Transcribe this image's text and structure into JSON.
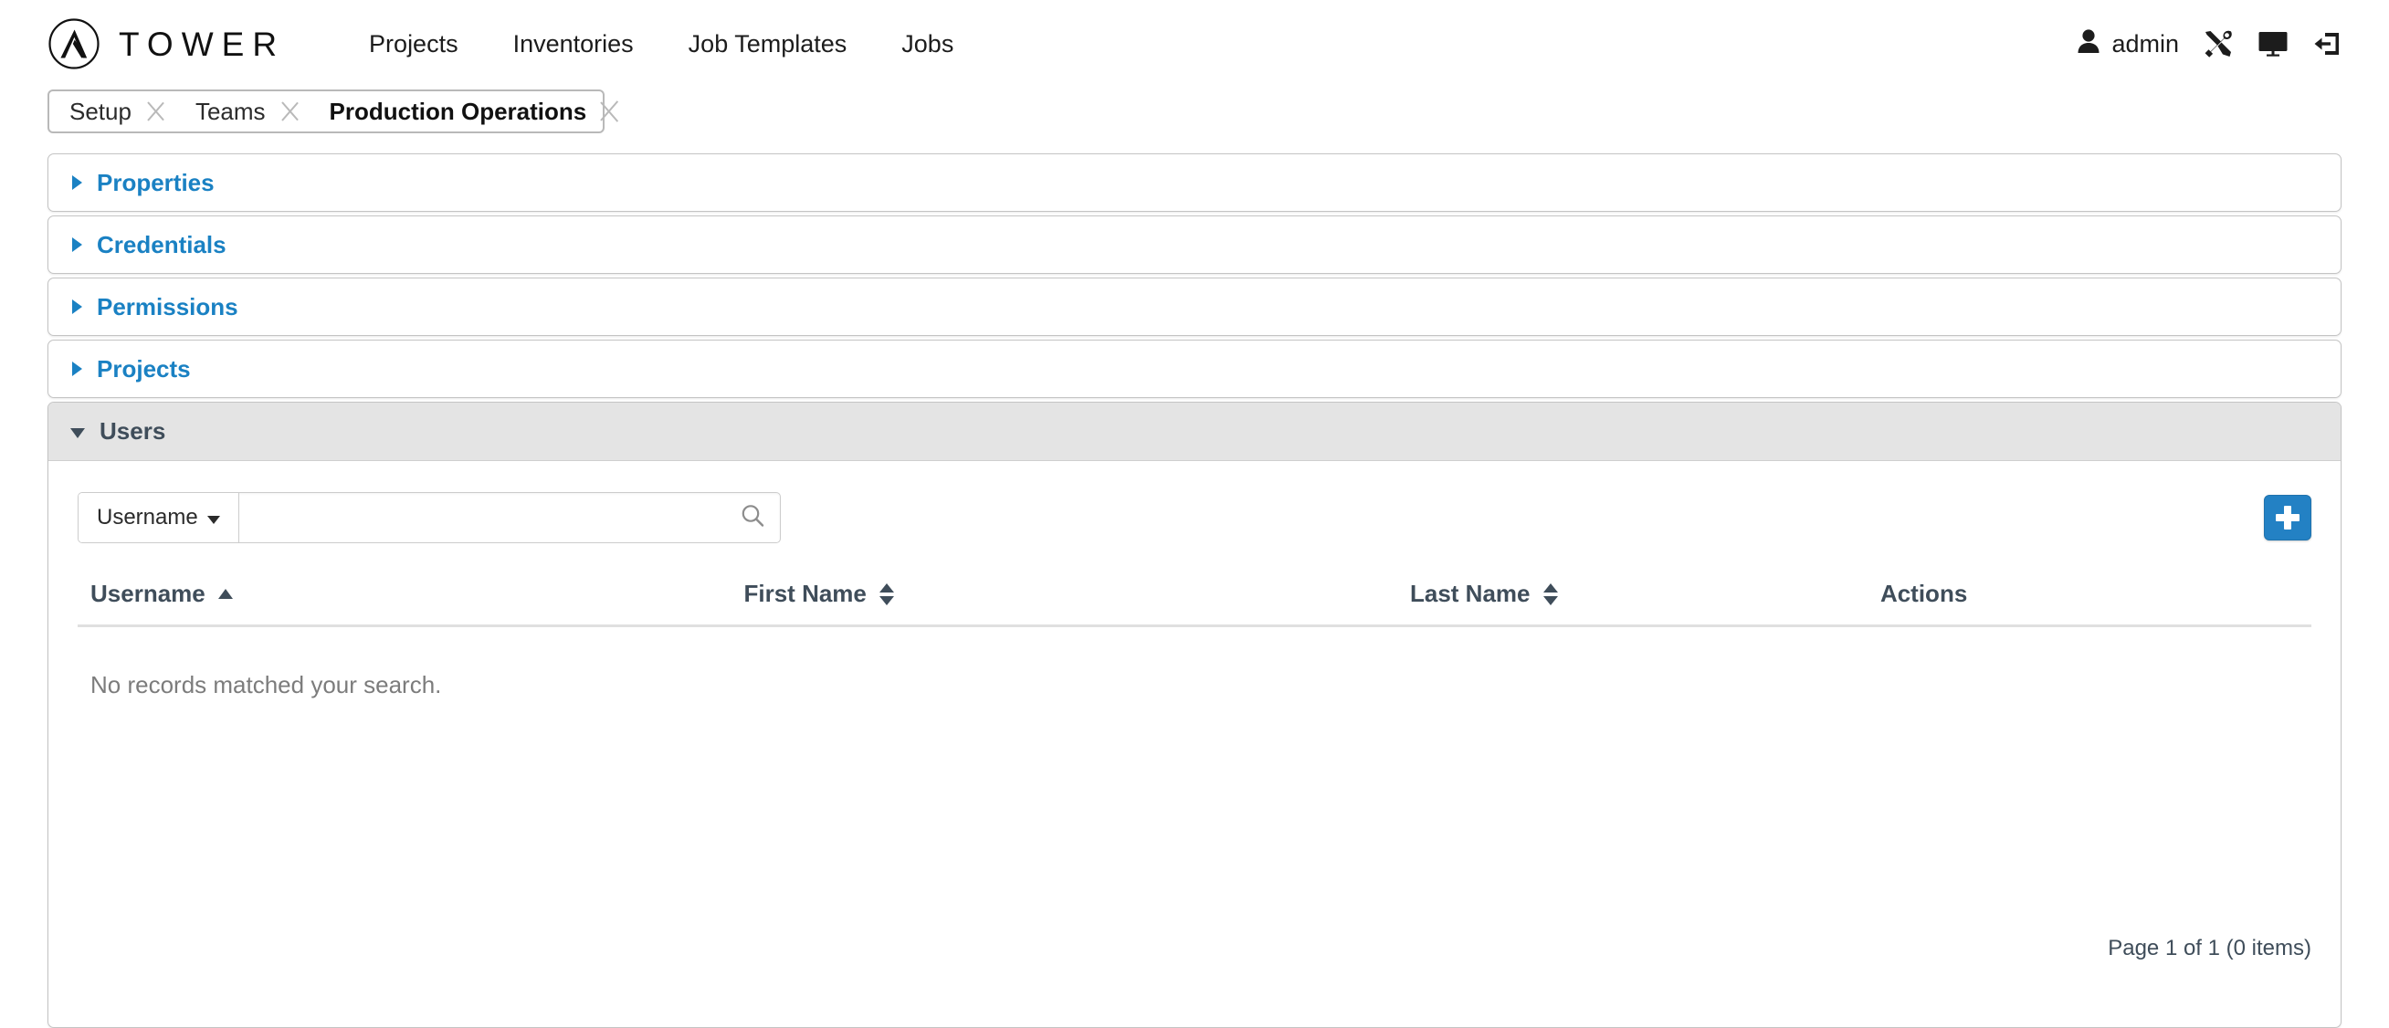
{
  "header": {
    "brand_name": "TOWER",
    "logo_icon": "ansible-a-logo-icon",
    "nav": [
      {
        "label": "Projects"
      },
      {
        "label": "Inventories"
      },
      {
        "label": "Job Templates"
      },
      {
        "label": "Jobs"
      }
    ],
    "user": {
      "name": "admin",
      "icon": "user-icon"
    },
    "actions": [
      {
        "icon": "tools-icon",
        "name": "settings-tools-button"
      },
      {
        "icon": "monitor-icon",
        "name": "monitor-button"
      },
      {
        "icon": "logout-icon",
        "name": "logout-button"
      }
    ]
  },
  "breadcrumb": [
    {
      "label": "Setup",
      "active": false
    },
    {
      "label": "Teams",
      "active": false
    },
    {
      "label": "Production Operations",
      "active": true
    }
  ],
  "panels": [
    {
      "label": "Properties",
      "expanded": false
    },
    {
      "label": "Credentials",
      "expanded": false
    },
    {
      "label": "Permissions",
      "expanded": false
    },
    {
      "label": "Projects",
      "expanded": false
    },
    {
      "label": "Users",
      "expanded": true
    }
  ],
  "users_panel": {
    "search": {
      "key_label": "Username",
      "value": "",
      "placeholder": "",
      "search_icon": "search-icon"
    },
    "add_button": {
      "label": "+",
      "icon": "plus-icon"
    },
    "table": {
      "columns": [
        {
          "label": "Username",
          "sortable": true,
          "sort": "asc"
        },
        {
          "label": "First Name",
          "sortable": true,
          "sort": "none"
        },
        {
          "label": "Last Name",
          "sortable": true,
          "sort": "none"
        },
        {
          "label": "Actions",
          "sortable": false,
          "sort": "none"
        }
      ],
      "rows": [],
      "empty_message": "No records matched your search."
    },
    "pagination": {
      "text": "Page 1 of 1 (0 items)",
      "page": 1,
      "total_pages": 1,
      "item_count": 0
    }
  },
  "colors": {
    "accent_blue": "#1a81c3",
    "button_blue": "#2381c4",
    "panel_header_gray": "#e4e4e4",
    "text_slate": "#3f4d5a",
    "muted_text": "#7c7c7c",
    "border_gray": "#c4c4c4"
  }
}
